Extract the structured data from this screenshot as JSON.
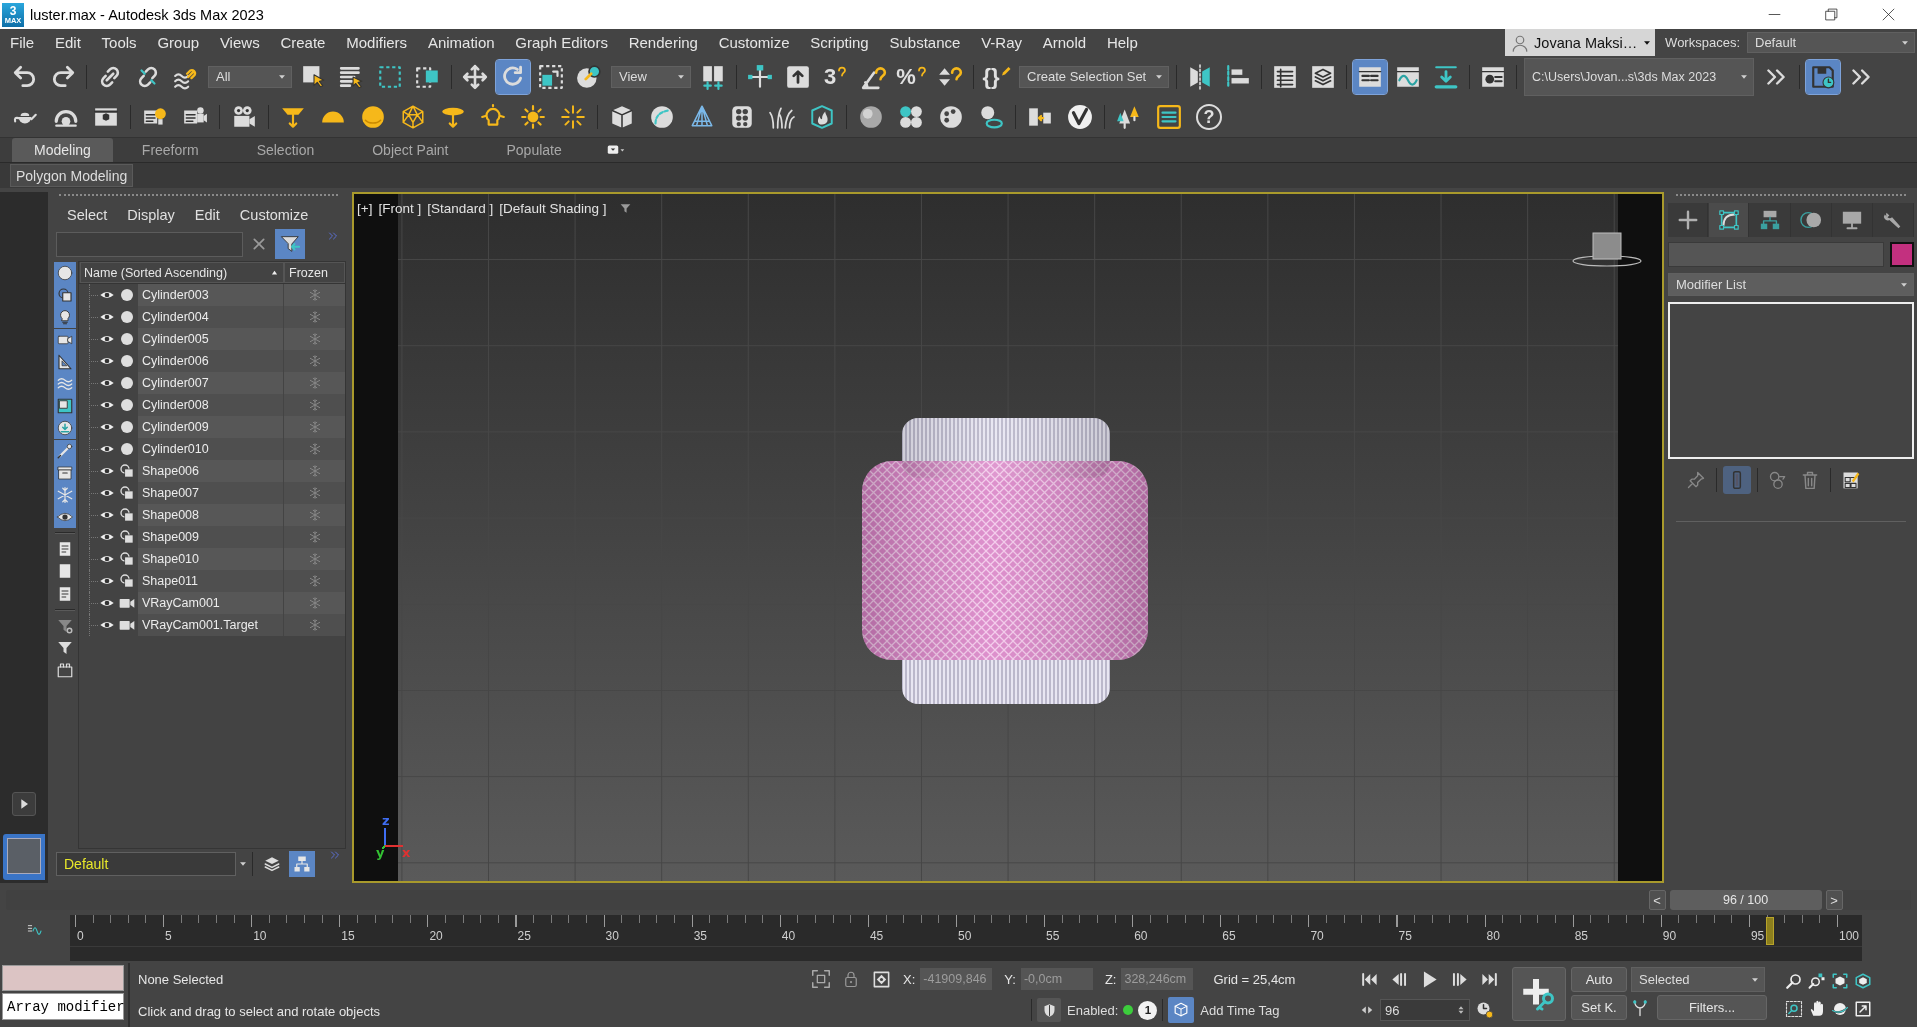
{
  "window": {
    "badge": "3",
    "badge_caption": "MAX",
    "title": "luster.max - Autodesk 3ds Max 2023"
  },
  "menu_bar": {
    "items": [
      "File",
      "Edit",
      "Tools",
      "Group",
      "Views",
      "Create",
      "Modifiers",
      "Animation",
      "Graph Editors",
      "Rendering",
      "Customize",
      "Scripting",
      "Substance",
      "V-Ray",
      "Arnold",
      "Help"
    ],
    "user": "Jovana Maksi…",
    "workspaces_label": "Workspaces:",
    "workspace": "Default"
  },
  "main_toolbar": [
    [
      {
        "kind": "button",
        "on": false
      },
      {
        "kind": "button",
        "on": false
      }
    ],
    [
      {
        "kind": "button",
        "on": false
      },
      {
        "kind": "button",
        "on": false
      },
      {
        "kind": "button",
        "on": false
      },
      {
        "kind": "dropdown",
        "value": "All"
      },
      {
        "kind": "button",
        "on": false
      },
      {
        "kind": "button",
        "on": false
      },
      {
        "kind": "button",
        "on": false
      },
      {
        "kind": "button",
        "on": false
      }
    ],
    [
      {
        "kind": "button",
        "on": false
      },
      {
        "kind": "button",
        "on": true
      },
      {
        "kind": "button",
        "on": false
      },
      {
        "kind": "button",
        "on": false
      },
      {
        "kind": "dropdown",
        "value": "View"
      },
      {
        "kind": "button",
        "on": false
      }
    ],
    [
      {
        "kind": "button",
        "on": false
      },
      {
        "kind": "button",
        "on": false
      },
      {
        "kind": "glyph",
        "glyph": "3",
        "on": false
      },
      {
        "kind": "button",
        "on": false
      },
      {
        "kind": "glyph",
        "glyph": "%",
        "on": false
      },
      {
        "kind": "button",
        "on": false
      }
    ],
    [
      {
        "kind": "glyph",
        "glyph": "{}",
        "on": false
      },
      {
        "kind": "dropdown",
        "value": "Create Selection Set"
      }
    ],
    [
      {
        "kind": "button",
        "on": false
      },
      {
        "kind": "button",
        "on": false
      }
    ],
    [
      {
        "kind": "button",
        "on": false
      },
      {
        "kind": "button",
        "on": false
      }
    ],
    [
      {
        "kind": "button",
        "on": true
      },
      {
        "kind": "button",
        "on": false
      },
      {
        "kind": "button",
        "on": false
      }
    ],
    [
      {
        "kind": "button",
        "on": false
      }
    ],
    [
      {
        "kind": "dropdown",
        "value": "C:\\Users\\Jovan...s\\3ds Max 2023"
      },
      {
        "kind": "button",
        "on": false
      }
    ],
    [
      {
        "kind": "button",
        "on": true
      },
      {
        "kind": "button",
        "on": false
      }
    ]
  ],
  "object_toolbar": [
    [
      {
        "kind": "button",
        "on": false
      },
      {
        "kind": "button",
        "on": false
      },
      {
        "kind": "button",
        "on": false
      }
    ],
    [
      {
        "kind": "button",
        "on": false
      },
      {
        "kind": "button",
        "on": false
      }
    ],
    [
      {
        "kind": "button",
        "on": false
      }
    ],
    [
      {
        "kind": "button",
        "on": false
      },
      {
        "kind": "button",
        "on": false
      },
      {
        "kind": "button",
        "on": false
      },
      {
        "kind": "button",
        "on": false
      },
      {
        "kind": "button",
        "on": false
      },
      {
        "kind": "button",
        "on": false
      },
      {
        "kind": "button",
        "on": false
      },
      {
        "kind": "button",
        "on": false
      }
    ],
    [
      {
        "kind": "button",
        "on": false
      },
      {
        "kind": "button",
        "on": false
      },
      {
        "kind": "button",
        "on": false
      },
      {
        "kind": "button",
        "on": false
      },
      {
        "kind": "button",
        "on": false
      },
      {
        "kind": "button",
        "on": false
      }
    ],
    [
      {
        "kind": "button",
        "on": false
      },
      {
        "kind": "button",
        "on": false
      },
      {
        "kind": "button",
        "on": false
      },
      {
        "kind": "button",
        "on": false
      }
    ],
    [
      {
        "kind": "button",
        "on": false
      },
      {
        "kind": "button",
        "on": false
      }
    ],
    [
      {
        "kind": "button",
        "on": false
      },
      {
        "kind": "button",
        "on": false
      },
      {
        "kind": "glyph",
        "glyph": "?",
        "on": false
      }
    ]
  ],
  "ribbon": {
    "tabs": [
      {
        "label": "Modeling",
        "selected": true
      },
      {
        "label": "Freeform",
        "selected": false
      },
      {
        "label": "Selection",
        "selected": false
      },
      {
        "label": "Object Paint",
        "selected": false
      },
      {
        "label": "Populate",
        "selected": false
      }
    ],
    "panel": "Polygon Modeling"
  },
  "scene_explorer": {
    "menu": [
      "Select",
      "Display",
      "Edit",
      "Customize"
    ],
    "filter_on": true,
    "side_filters": [
      {
        "on": true
      },
      {
        "on": true
      },
      {
        "on": true
      },
      {
        "on": true
      },
      {
        "on": true
      },
      {
        "on": true
      },
      {
        "on": true
      },
      {
        "on": true
      },
      {
        "on": true
      },
      {
        "on": true
      },
      {
        "on": true
      },
      {
        "on": true
      },
      {
        "on": false
      },
      {
        "on": false
      },
      {
        "on": false
      }
    ],
    "columns": [
      "Name (Sorted Ascending)",
      "Frozen"
    ],
    "rows": [
      {
        "name": "Cylinder003",
        "kind": "geometry",
        "selected": false
      },
      {
        "name": "Cylinder004",
        "kind": "geometry",
        "selected": false
      },
      {
        "name": "Cylinder005",
        "kind": "geometry",
        "selected": false
      },
      {
        "name": "Cylinder006",
        "kind": "geometry",
        "selected": false
      },
      {
        "name": "Cylinder007",
        "kind": "geometry",
        "selected": false
      },
      {
        "name": "Cylinder008",
        "kind": "geometry",
        "selected": false
      },
      {
        "name": "Cylinder009",
        "kind": "geometry",
        "selected": false
      },
      {
        "name": "Cylinder010",
        "kind": "geometry",
        "selected": false
      },
      {
        "name": "Shape006",
        "kind": "shape",
        "selected": false
      },
      {
        "name": "Shape007",
        "kind": "shape",
        "selected": false
      },
      {
        "name": "Shape008",
        "kind": "shape",
        "selected": false
      },
      {
        "name": "Shape009",
        "kind": "shape",
        "selected": false
      },
      {
        "name": "Shape010",
        "kind": "shape",
        "selected": false
      },
      {
        "name": "Shape011",
        "kind": "shape",
        "selected": false
      },
      {
        "name": "VRayCam001",
        "kind": "camera",
        "selected": false
      },
      {
        "name": "VRayCam001.Target",
        "kind": "camera",
        "selected": false
      }
    ],
    "layer": "Default",
    "sort_buttons": [
      {
        "on": false
      },
      {
        "on": true
      }
    ]
  },
  "viewport": {
    "labels": [
      "[+]",
      "[Front ]",
      "[Standard ]",
      "[Default Shading ]"
    ],
    "axes": [
      {
        "label": "z",
        "color": "#3f6df2"
      },
      {
        "label": "y",
        "color": "#33c233"
      },
      {
        "label": "x",
        "color": "#e03131"
      }
    ]
  },
  "command_panel": {
    "tabs": [
      {
        "selected": false
      },
      {
        "selected": true
      },
      {
        "selected": false
      },
      {
        "selected": false
      },
      {
        "selected": false
      },
      {
        "selected": false
      }
    ],
    "swatch": {
      "color": "#c3307f"
    },
    "modifier_list": "Modifier List",
    "stack_buttons": [
      {
        "on": false
      },
      {
        "on": true
      },
      {
        "on": false
      },
      {
        "on": false
      },
      {
        "on": false
      }
    ]
  },
  "timeline": {
    "time_slider": {
      "prev": "<",
      "label": "96 / 100",
      "next": ">",
      "level": 0.96
    },
    "frame_labels": [
      "0",
      "5",
      "10",
      "15",
      "20",
      "25",
      "30",
      "35",
      "40",
      "45",
      "50",
      "55",
      "60",
      "65",
      "70",
      "75",
      "80",
      "85",
      "90",
      "95",
      "100"
    ]
  },
  "status_bar": {
    "listener_output": "Array modifier",
    "selection": "None Selected",
    "prompt": "Click and drag to select and rotate objects",
    "coordinates": [
      {
        "label": "X:",
        "value": "-41909,846",
        "disabled": true
      },
      {
        "label": "Y:",
        "value": "-0,0cm",
        "disabled": true
      },
      {
        "label": "Z:",
        "value": "328,246cm",
        "disabled": true
      }
    ],
    "grid": "Grid = 25,4cm",
    "adaptive_label": "Enabled:",
    "adaptive_on": true,
    "badge": "1",
    "time_tag": "Add Time Tag",
    "frame": "96",
    "key_buttons": [
      {
        "label": "Auto",
        "on": false
      },
      {
        "label": "Set K.",
        "on": false
      }
    ],
    "key_set": "Selected",
    "filters": "Filters..."
  }
}
